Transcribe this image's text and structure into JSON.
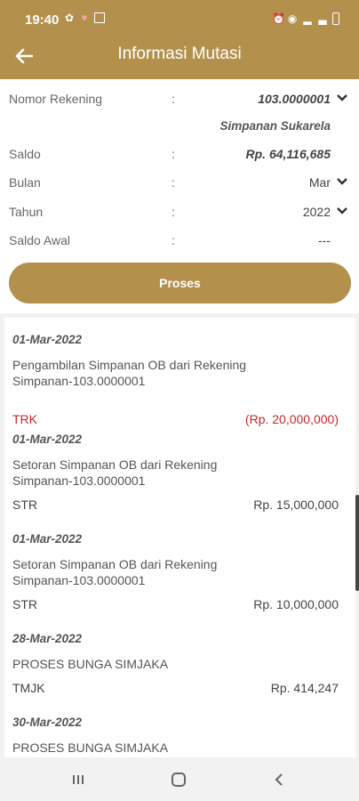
{
  "status_bar": {
    "time": "19:40"
  },
  "header": {
    "title": "Informasi Mutasi"
  },
  "form": {
    "rows": [
      {
        "label": "Nomor Rekening",
        "colon": ":",
        "value": "103.0000001"
      },
      {
        "label": "Saldo",
        "colon": ":",
        "value": "Rp. 64,116,685"
      },
      {
        "label": "Bulan",
        "colon": ":",
        "value": "Mar"
      },
      {
        "label": "Tahun",
        "colon": ":",
        "value": "2022"
      },
      {
        "label": "Saldo Awal",
        "colon": ":",
        "value": "---"
      }
    ],
    "account_type": "Simpanan Sukarela",
    "button_label": "Proses"
  },
  "transactions": [
    {
      "date": "01-Mar-2022",
      "description": "Pengambilan Simpanan OB dari Rekening Simpanan-103.0000001",
      "code": "TRK",
      "amount": "(Rp. 20,000,000)"
    },
    {
      "date": "01-Mar-2022",
      "description": "Setoran Simpanan OB dari Rekening Simpanan-103.0000001",
      "code": "STR",
      "amount": "Rp. 15,000,000"
    },
    {
      "date": "01-Mar-2022",
      "description": "Setoran Simpanan OB dari Rekening Simpanan-103.0000001",
      "code": "STR",
      "amount": "Rp. 10,000,000"
    },
    {
      "date": "28-Mar-2022",
      "description": "PROSES BUNGA SIMJAKA",
      "code": "TMJK",
      "amount": "Rp. 414,247"
    },
    {
      "date": "30-Mar-2022",
      "description": "PROSES BUNGA SIMJAKA",
      "code": "",
      "amount": ""
    }
  ],
  "colors": {
    "brand": "#b3914d",
    "debit": "#c62828"
  },
  "icons": {
    "back": "arrow-left-icon",
    "dropdown": "chevron-down-icon",
    "nav_recent": "recent-apps-icon",
    "nav_home": "home-icon",
    "nav_back": "nav-back-icon"
  }
}
